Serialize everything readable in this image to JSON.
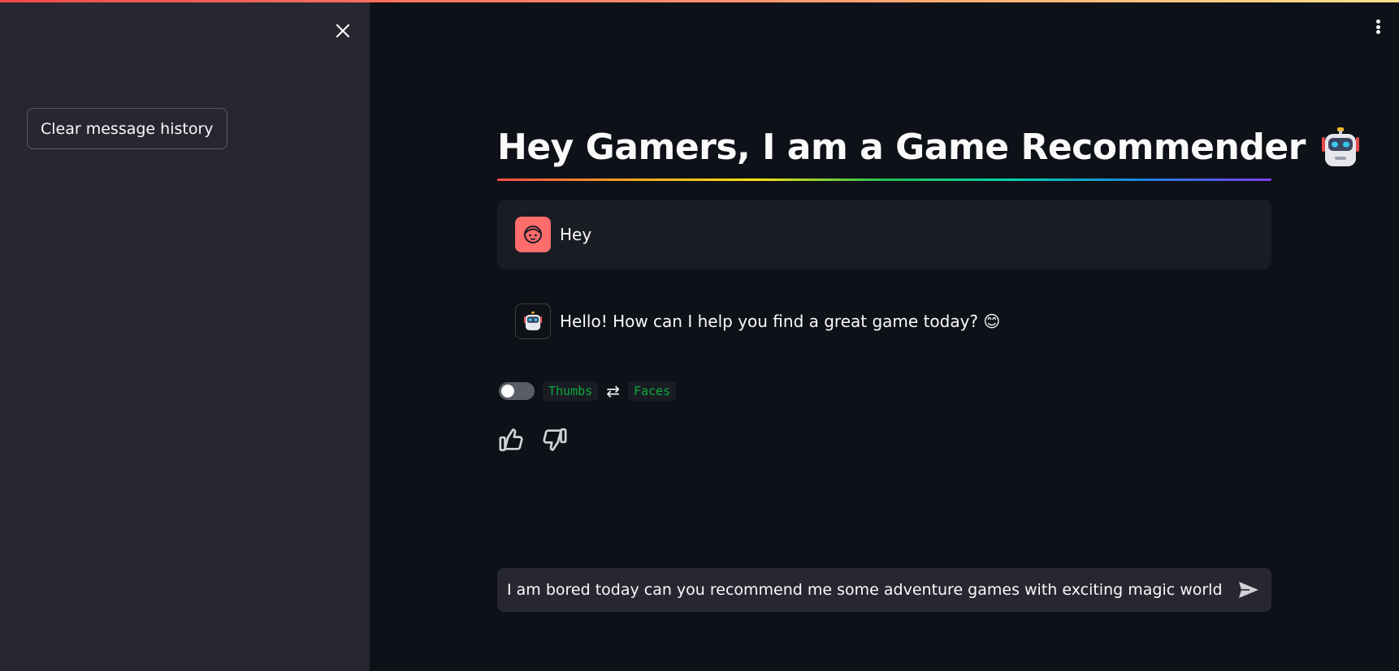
{
  "sidebar": {
    "clear_label": "Clear message history",
    "close_icon": "close-icon"
  },
  "header": {
    "menu_icon": "kebab-menu-icon"
  },
  "page": {
    "title": "Hey Gamers, I am a Game Recommender",
    "title_icon": "robot-icon"
  },
  "messages": [
    {
      "role": "user",
      "avatar": "user-face-icon",
      "text": "Hey"
    },
    {
      "role": "assistant",
      "avatar": "robot-icon",
      "text": "Hello! How can I help you find a great game today? 😊"
    }
  ],
  "feedback_toggle": {
    "left_label": "Thumbs",
    "swap_symbol": "⇄",
    "right_label": "Faces",
    "checked": false
  },
  "feedback": {
    "up_icon": "thumbs-up-icon",
    "down_icon": "thumbs-down-icon"
  },
  "chat_input": {
    "value": "I am bored today can you recommend me some adventure games with exciting magic world?",
    "send_icon": "send-icon"
  },
  "colors": {
    "bg": "#0e1117",
    "sidebar": "#262730",
    "user_avatar": "#ff6c6c",
    "code_green": "#09ab3b"
  }
}
